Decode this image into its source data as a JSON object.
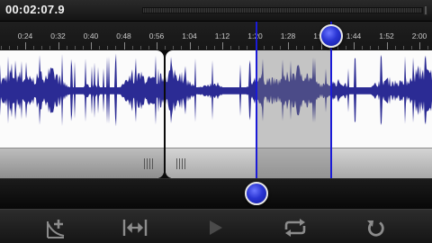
{
  "header": {
    "time": "00:02:07.9"
  },
  "ruler": {
    "labels": [
      "0:24",
      "0:32",
      "0:40",
      "0:48",
      "0:56",
      "1:04",
      "1:12",
      "1:20",
      "1:28",
      "1:36",
      "1:44",
      "1:52",
      "2:00"
    ]
  },
  "toolbar": {
    "buttons": [
      {
        "name": "add-marker",
        "icon": "add-marker-icon"
      },
      {
        "name": "fit-width",
        "icon": "fit-width-icon"
      },
      {
        "name": "play",
        "icon": "play-icon"
      },
      {
        "name": "loop",
        "icon": "loop-icon"
      },
      {
        "name": "undo",
        "icon": "undo-icon"
      }
    ]
  },
  "colors": {
    "waveform": "#2b2b94",
    "selection_line": "#1b1bd8",
    "knob": "#2a35d4"
  }
}
